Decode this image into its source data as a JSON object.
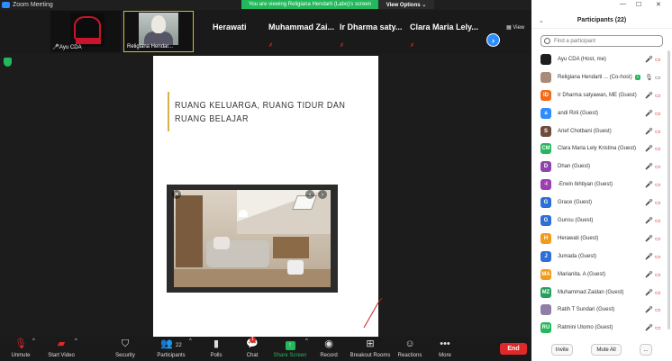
{
  "window": {
    "title": "Zoom Meeting"
  },
  "share_banner": {
    "message": "You are viewing Religiana Hendarti (Labo)'s screen",
    "options_label": "View Options ⌄"
  },
  "video_strip": {
    "tiles": [
      {
        "name": "Ayu CDA"
      },
      {
        "name": "Religiana Hendar..."
      }
    ],
    "names": [
      "Herawati",
      "Muhammad Zai...",
      "Ir  Dharma saty...",
      "Clara Maria Lely..."
    ],
    "view_label": "View"
  },
  "slide": {
    "heading": "RUANG KELUARGA, RUANG TIDUR DAN RUANG BELAJAR"
  },
  "toolbar": {
    "unmute": "Unmute",
    "start_video": "Start Video",
    "security": "Security",
    "participants": "Participants",
    "participants_count": "22",
    "polls": "Polls",
    "chat": "Chat",
    "chat_badge": "1",
    "share_screen": "Share Screen",
    "record": "Record",
    "breakout_rooms": "Breakout Rooms",
    "reactions": "Reactions",
    "more": "More",
    "end": "End"
  },
  "panel": {
    "title": "Participants (22)",
    "search_placeholder": "Find a participant",
    "participants": [
      {
        "initials": "",
        "name": "Ayu CDA (Host, me)",
        "color": "#1e1e1e"
      },
      {
        "initials": "",
        "name": "Religiana Hendarti ... (Co-host)",
        "color": "#a88b76"
      },
      {
        "initials": "ID",
        "name": "Ir  Dharma satyawan, ME (Guest)",
        "color": "#f26a1b"
      },
      {
        "initials": "a",
        "name": "andi Ririi (Guest)",
        "color": "#2d8cff"
      },
      {
        "initials": "S",
        "name": "Arief Chotbani (Guest)",
        "color": "#6e4b3a"
      },
      {
        "initials": "CM",
        "name": "Clara Maria Lely Kristina (Guest)",
        "color": "#23b85b"
      },
      {
        "initials": "D",
        "name": "Dhan (Guest)",
        "color": "#8e44ad"
      },
      {
        "initials": "-I",
        "name": "-Erwin Ikhtiyan (Guest)",
        "color": "#9b3fb0"
      },
      {
        "initials": "G",
        "name": "Grace (Guest)",
        "color": "#2d6fd6"
      },
      {
        "initials": "G",
        "name": "Gunsu (Guest)",
        "color": "#2d6fd6"
      },
      {
        "initials": "H",
        "name": "Herawati (Guest)",
        "color": "#f29a1b"
      },
      {
        "initials": "J",
        "name": "Jumada (Guest)",
        "color": "#2d6fd6"
      },
      {
        "initials": "MA",
        "name": "Marianita. A (Guest)",
        "color": "#f29a1b"
      },
      {
        "initials": "MZ",
        "name": "Muhammad Zaidan (Guest)",
        "color": "#23a05b"
      },
      {
        "initials": "",
        "name": "Ratih T Sundari (Guest)",
        "color": "#8f7fa6"
      },
      {
        "initials": "RU",
        "name": "Ratmini Utomo (Guest)",
        "color": "#23b85b"
      }
    ],
    "invite": "Invite",
    "mute_all": "Mute All",
    "more": "..."
  },
  "colors": {
    "accent": "#2d8cff",
    "share_green": "#23b85b",
    "danger": "#e02828"
  }
}
